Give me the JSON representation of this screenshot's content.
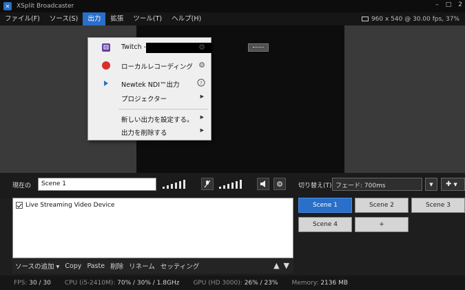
{
  "window": {
    "title": "XSplit Broadcaster",
    "controls": [
      "–",
      "□",
      "2"
    ]
  },
  "menu": {
    "items": [
      "ファイル(F)",
      "ソース(S)",
      "出力",
      "拡張",
      "ツール(T)",
      "ヘルプ(H)"
    ],
    "active_index": 2,
    "resolution_info": "960 x 540 @ 30.00 fps, 37%"
  },
  "output_menu": {
    "items": [
      {
        "label": "Twitch -",
        "icon": "twitch-icon",
        "right": "gear"
      },
      {
        "label": "ローカルレコーディング",
        "icon": "record-icon",
        "right": "gear"
      },
      {
        "label": "Newtek NDI™出力",
        "icon": "ndi-icon",
        "right": "help"
      },
      {
        "label": "プロジェクター",
        "icon": "",
        "right": "submenu"
      },
      {
        "label": "新しい出力を設定する。",
        "icon": "",
        "right": "submenu"
      },
      {
        "label": "出力を削除する",
        "icon": "",
        "right": "submenu"
      }
    ],
    "colors": {
      "twitch": "#6441a4",
      "record": "#d9302a"
    }
  },
  "scene_bar": {
    "current_label": "現在の",
    "current_scene": "Scene 1",
    "transition_label": "切り替え(T)",
    "transition_value": "フェード: 700ms"
  },
  "sources": {
    "items": [
      {
        "label": "Live Streaming Video Device",
        "checked": true
      }
    ],
    "toolbar": [
      "ソースの追加 ▾",
      "Copy",
      "Paste",
      "削除",
      "リネーム",
      "セッティング"
    ]
  },
  "scenes": {
    "buttons": [
      "Scene 1",
      "Scene 2",
      "Scene 3",
      "Scene 4",
      "+"
    ],
    "active_index": 0
  },
  "status": {
    "fps_label": "FPS:",
    "fps_value": "30 / 30",
    "cpu_label": "CPU (i5-2410M):",
    "cpu_value": "70% / 30% / 1.8GHz",
    "gpu_label": "GPU (HD 3000):",
    "gpu_value": "26% / 23%",
    "memory_label": "Memory:",
    "memory_value": "2136 MB"
  }
}
